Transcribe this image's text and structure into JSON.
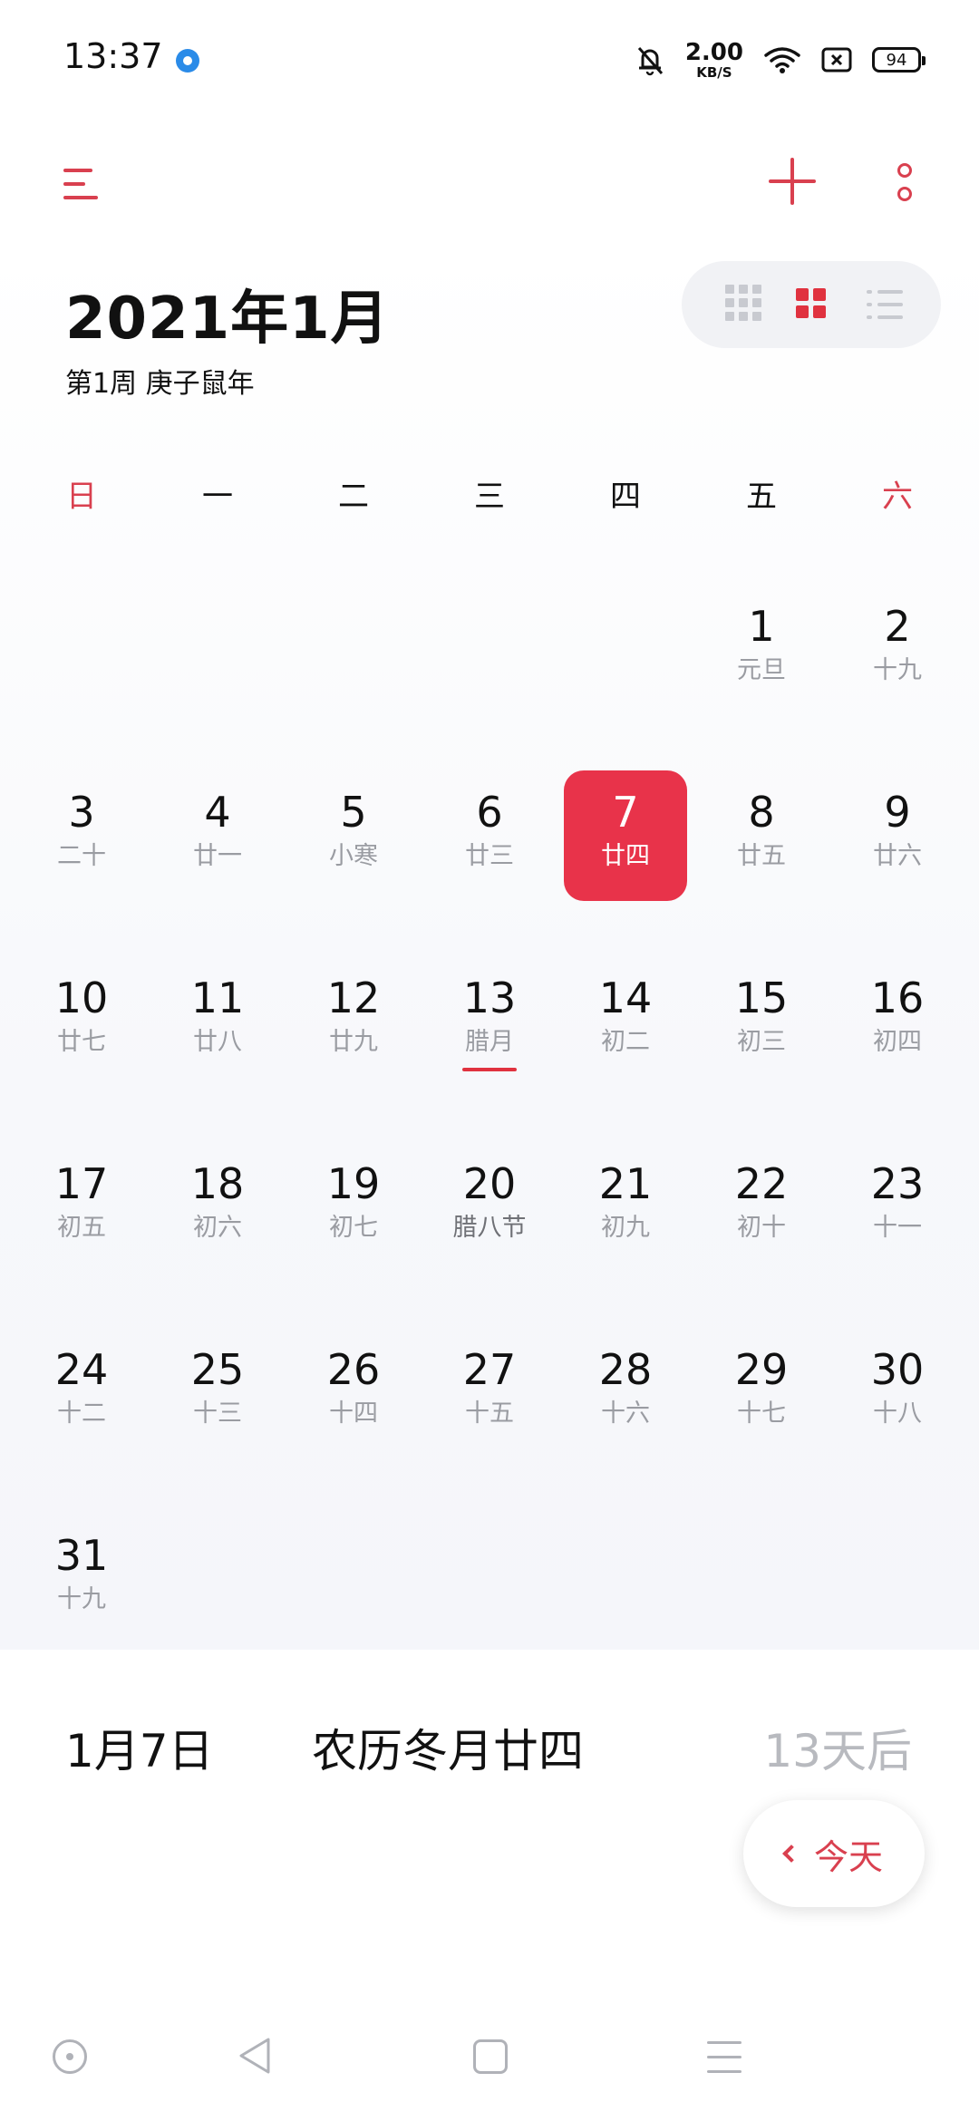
{
  "status_bar": {
    "time": "13:37",
    "net_speed_value": "2.00",
    "net_speed_unit": "KB/S",
    "battery": "94",
    "icons": [
      "location-dot-icon",
      "bell-off-icon",
      "wifi-icon",
      "sim-no-signal-icon",
      "battery-icon"
    ]
  },
  "app_bar": {
    "icons": [
      "menu-icon",
      "add-icon",
      "more-icon"
    ],
    "accent_color": "#d9404f"
  },
  "header": {
    "month_title": "2021年1月",
    "week_info": "第1周 庚子鼠年",
    "view_switch": [
      "year-view-icon",
      "month-view-icon",
      "list-view-icon"
    ],
    "active_view": "month"
  },
  "weekdays": [
    "日",
    "一",
    "二",
    "三",
    "四",
    "五",
    "六"
  ],
  "selected_day": "7",
  "selected_color": "#e8334a",
  "days": [
    {
      "day": "",
      "lunar": ""
    },
    {
      "day": "",
      "lunar": ""
    },
    {
      "day": "",
      "lunar": ""
    },
    {
      "day": "",
      "lunar": ""
    },
    {
      "day": "",
      "lunar": ""
    },
    {
      "day": "1",
      "lunar": "元旦"
    },
    {
      "day": "2",
      "lunar": "十九"
    },
    {
      "day": "3",
      "lunar": "二十"
    },
    {
      "day": "4",
      "lunar": "廿一"
    },
    {
      "day": "5",
      "lunar": "小寒"
    },
    {
      "day": "6",
      "lunar": "廿三"
    },
    {
      "day": "7",
      "lunar": "廿四"
    },
    {
      "day": "8",
      "lunar": "廿五"
    },
    {
      "day": "9",
      "lunar": "廿六"
    },
    {
      "day": "10",
      "lunar": "廿七"
    },
    {
      "day": "11",
      "lunar": "廿八"
    },
    {
      "day": "12",
      "lunar": "廿九"
    },
    {
      "day": "13",
      "lunar": "腊月"
    },
    {
      "day": "14",
      "lunar": "初二"
    },
    {
      "day": "15",
      "lunar": "初三"
    },
    {
      "day": "16",
      "lunar": "初四"
    },
    {
      "day": "17",
      "lunar": "初五"
    },
    {
      "day": "18",
      "lunar": "初六"
    },
    {
      "day": "19",
      "lunar": "初七"
    },
    {
      "day": "20",
      "lunar": "腊八节"
    },
    {
      "day": "21",
      "lunar": "初九"
    },
    {
      "day": "22",
      "lunar": "初十"
    },
    {
      "day": "23",
      "lunar": "十一"
    },
    {
      "day": "24",
      "lunar": "十二"
    },
    {
      "day": "25",
      "lunar": "十三"
    },
    {
      "day": "26",
      "lunar": "十四"
    },
    {
      "day": "27",
      "lunar": "十五"
    },
    {
      "day": "28",
      "lunar": "十六"
    },
    {
      "day": "29",
      "lunar": "十七"
    },
    {
      "day": "30",
      "lunar": "十八"
    },
    {
      "day": "31",
      "lunar": "十九"
    }
  ],
  "detail": {
    "date": "1月7日",
    "lunar": "农历冬月廿四",
    "relative": "13天后"
  },
  "today_button": {
    "label": "今天",
    "icon": "chevron-left-icon"
  },
  "nav_bar": {
    "icons": [
      "nav-circle-icon",
      "nav-back-icon",
      "nav-home-icon",
      "nav-menu-icon"
    ]
  }
}
